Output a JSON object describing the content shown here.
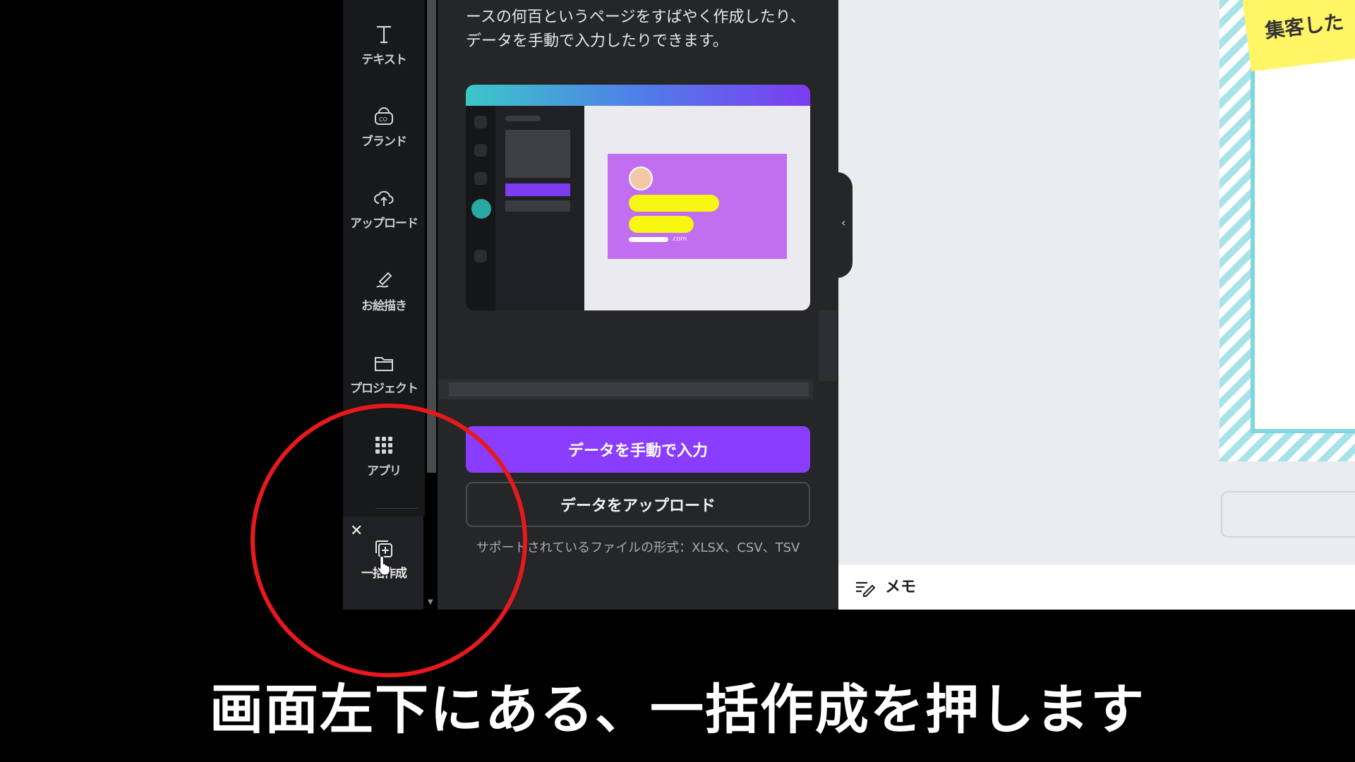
{
  "rail": {
    "items": [
      {
        "label": "テキスト",
        "icon": "text-icon"
      },
      {
        "label": "ブランド",
        "icon": "brand-icon"
      },
      {
        "label": "アップロード",
        "icon": "upload-cloud-icon"
      },
      {
        "label": "お絵描き",
        "icon": "draw-icon"
      },
      {
        "label": "プロジェクト",
        "icon": "folder-icon"
      },
      {
        "label": "アプリ",
        "icon": "apps-grid-icon"
      }
    ],
    "bulk": {
      "close": "✕",
      "label": "一括作成",
      "icon": "bulk-create-icon"
    }
  },
  "panel": {
    "description": "ースの何百というページをすばやく作成したり、データを手動で入力したりできます。",
    "manual_button": "データを手動で入力",
    "upload_button": "データをアップロード",
    "supported_formats": "サポートされているファイルの形式：XLSX、CSV、TSV",
    "illustration_email": ".com"
  },
  "editor": {
    "sticky_text": "集客した",
    "memo_label": "メモ",
    "collapse_glyph": "‹"
  },
  "overlay": {
    "subtitle": "画面左下にある、一括作成を押します",
    "circle_color": "#e7191c"
  },
  "colors": {
    "accent": "#8b3dff",
    "rail_bg": "#18191b",
    "panel_bg": "#252628"
  }
}
